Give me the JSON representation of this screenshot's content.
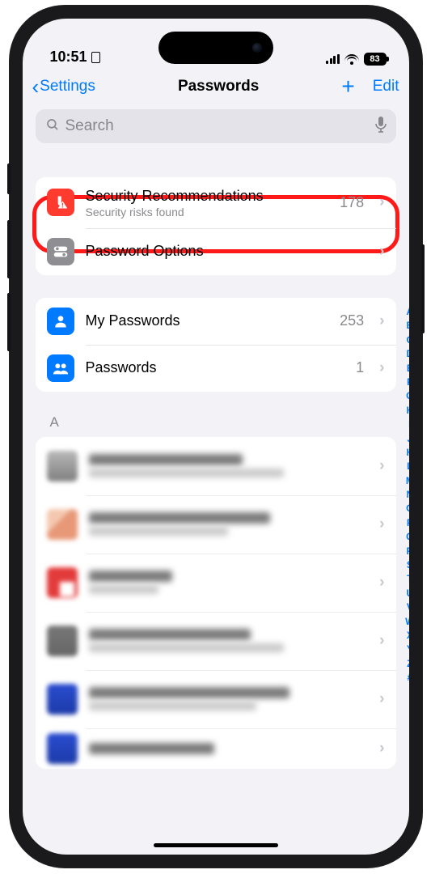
{
  "status": {
    "time": "10:51",
    "battery": "83"
  },
  "nav": {
    "back": "Settings",
    "title": "Passwords",
    "edit": "Edit"
  },
  "search": {
    "placeholder": "Search"
  },
  "top_group": [
    {
      "title": "Security Recommendations",
      "subtitle": "Security risks found",
      "count": "178"
    },
    {
      "title": "Password Options"
    }
  ],
  "mid_group": [
    {
      "title": "My Passwords",
      "count": "253"
    },
    {
      "title": "Passwords",
      "count": "1"
    }
  ],
  "section_a": "A",
  "index_chars": [
    "A",
    "B",
    "C",
    "D",
    "E",
    "F",
    "G",
    "H",
    "I",
    "J",
    "K",
    "L",
    "M",
    "N",
    "O",
    "P",
    "Q",
    "R",
    "S",
    "T",
    "U",
    "V",
    "W",
    "X",
    "Y",
    "Z",
    "#"
  ]
}
